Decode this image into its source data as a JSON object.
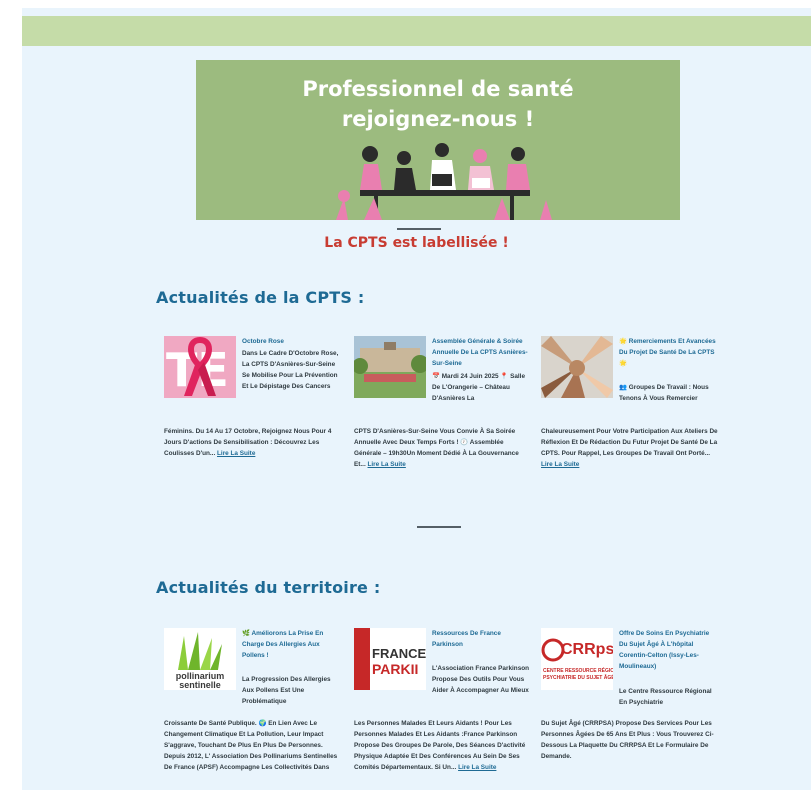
{
  "banner": {
    "title_line1": "Professionnel de santé",
    "title_line2": "rejoignez-nous !"
  },
  "label": "La CPTS est labellisée !",
  "sections": [
    {
      "title": "Actualités de la CPTS :",
      "cards": [
        {
          "head": "Octobre Rose",
          "body_top": "Dans Le Cadre D'Octobre Rose, La CPTS D'Asnières-Sur-Seine Se Mobilise Pour La Prévention Et Le Dépistage Des Cancers",
          "body_full": "Féminins. Du 14 Au 17 Octobre, Rejoignez Nous Pour 4 Jours D'actions De Sensibilisation : Découvrez Les Coulisses D'un...",
          "more": "Lire La Suite",
          "thumb_text": "TE"
        },
        {
          "head": "Assemblée Générale & Soirée Annuelle De La CPTS Asnières-Sur-Seine",
          "body_top": "📅 Mardi 24 Juin 2025 📍 Salle De L'Orangerie – Château D'Asnières La",
          "body_full": "CPTS D'Asnières-Sur-Seine Vous Convie À Sa Soirée Annuelle Avec Deux Temps Forts ! 🕖 Assemblée Générale – 19h30Un Moment Dédié À La Gouvernance Et...",
          "more": "Lire La Suite"
        },
        {
          "head": "🌟 Remerciements Et Avancées Du Projet De Santé De La CPTS 🌟",
          "body_top": "👥 Groupes De Travail : Nous Tenons À Vous Remercier",
          "body_full": "Chaleureusement Pour Votre Participation Aux Ateliers De Réflexion Et De Rédaction Du Futur Projet De Santé De La CPTS. Pour Rappel, Les Groupes De Travail Ont Porté...",
          "more": "Lire La Suite"
        }
      ]
    },
    {
      "title": "Actualités du territoire :",
      "cards": [
        {
          "head": "🌿 Améliorons La Prise En Charge Des Allergies Aux Pollens !",
          "body_top": "La Progression Des Allergies Aux Pollens Est Une Problématique",
          "body_full": "Croissante De Santé Publique. 🌍 En Lien Avec Le Changement Climatique Et La Pollution, Leur Impact S'aggrave, Touchant De Plus En Plus De Personnes. Depuis 2012, L' Association Des Pollinariums Sentinelles De France (APSF) Accompagne Les Collectivités Dans",
          "more": "",
          "thumb_text1": "pollinarium",
          "thumb_text2": "sentinelle"
        },
        {
          "head": "Ressources De France Parkinson",
          "body_top": "L'Association France Parkinson Propose Des Outils Pour Vous Aider À Accompagner Au Mieux",
          "body_full": "Les Personnes Malades Et Leurs Aidants ! Pour Les Personnes Malades Et Les Aidants :France Parkinson Propose Des Groupes De Parole, Des Séances D'activité Physique Adaptée Et Des Conférences Au Sein De Ses Comités Départementaux. Si Un...",
          "more": "Lire La Suite",
          "thumb_text1": "FRANCE",
          "thumb_text2": "PARKII"
        },
        {
          "head": "Offre De Soins En Psychiatrie Du Sujet Âgé À L'hôpital Corentin-Celton (Issy-Les-Moulineaux)",
          "body_top": "Le Centre Ressource Régional En Psychiatrie",
          "body_full": "Du Sujet Âgé (CRRPSA) Propose Des Services Pour Les Personnes Âgées De 65 Ans Et Plus : Vous Trouverez Ci-Dessous La Plaquette Du CRRPSA Et Le Formulaire De Demande.",
          "more": "",
          "thumb_text1": "CRRps",
          "thumb_text2": "CENTRE RESSOURCE RÉGIONAL EN",
          "thumb_text3": "PSYCHIATRIE DU SUJET ÂGÉ"
        }
      ]
    }
  ]
}
